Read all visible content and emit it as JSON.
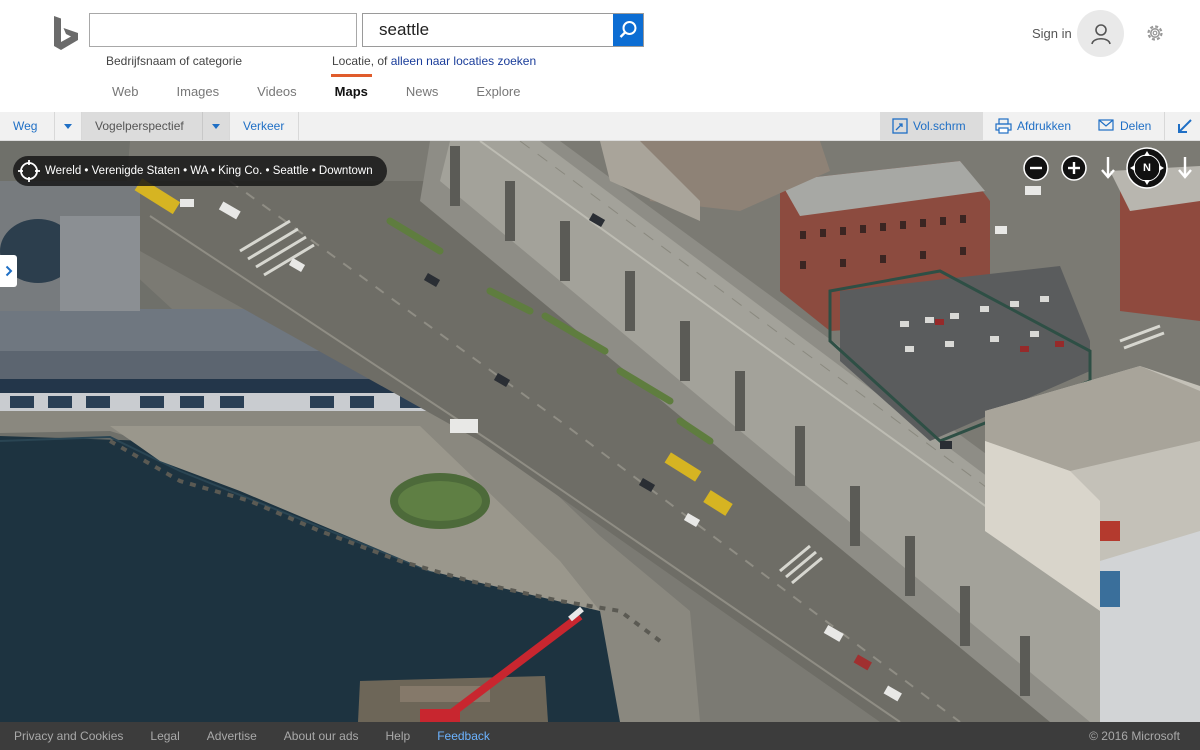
{
  "search": {
    "what_value": "",
    "where_value": "seattle",
    "what_hint": "Bedrijfsnaam of categorie",
    "where_hint_prefix": "Locatie, of ",
    "where_hint_link": "alleen naar locaties zoeken"
  },
  "scopes": [
    {
      "label": "Web"
    },
    {
      "label": "Images"
    },
    {
      "label": "Videos"
    },
    {
      "label": "Maps",
      "active": true
    },
    {
      "label": "News"
    },
    {
      "label": "Explore"
    }
  ],
  "account": {
    "sign_in_label": "Sign in"
  },
  "toolbar": {
    "road": "Weg",
    "birdseye": "Vogelperspectief",
    "traffic": "Verkeer",
    "fullscreen": "Vol.schrm",
    "print": "Afdrukken",
    "share": "Delen"
  },
  "map": {
    "breadcrumb": "Wereld • Verenigde Staten • WA • King Co. • Seattle • Downtown",
    "compass_label": "N",
    "view": "Vogelperspectief"
  },
  "footer": {
    "links": [
      "Privacy and Cookies",
      "Legal",
      "Advertise",
      "About our ads",
      "Help",
      "Feedback"
    ],
    "copyright": "© 2016 Microsoft"
  },
  "colors": {
    "accent_blue": "#0c6dd3",
    "active_scope_underline": "#e05c2c",
    "link_blue": "#1f6fc5",
    "water": "#1d3340",
    "footer_bg": "#3c3c3c"
  }
}
